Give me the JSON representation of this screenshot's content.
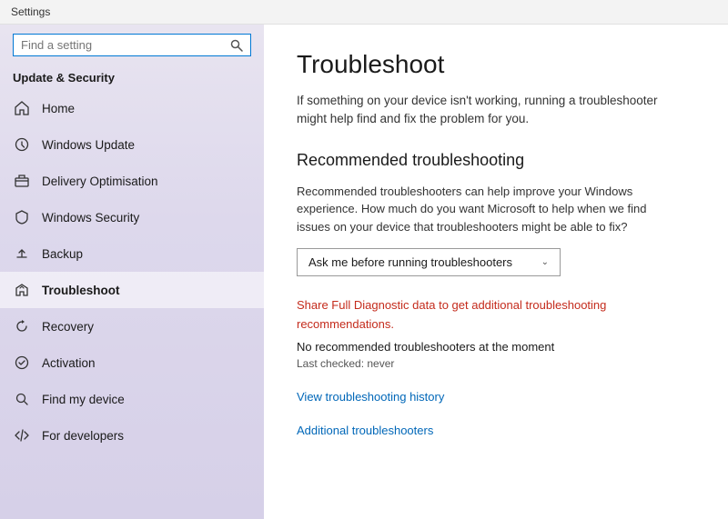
{
  "titleBar": {
    "label": "Settings"
  },
  "sidebar": {
    "searchPlaceholder": "Find a setting",
    "sectionTitle": "Update & Security",
    "items": [
      {
        "id": "home",
        "label": "Home",
        "icon": "home"
      },
      {
        "id": "windows-update",
        "label": "Windows Update",
        "icon": "windows-update"
      },
      {
        "id": "delivery-optimisation",
        "label": "Delivery Optimisation",
        "icon": "delivery"
      },
      {
        "id": "windows-security",
        "label": "Windows Security",
        "icon": "shield"
      },
      {
        "id": "backup",
        "label": "Backup",
        "icon": "backup"
      },
      {
        "id": "troubleshoot",
        "label": "Troubleshoot",
        "icon": "troubleshoot",
        "active": true
      },
      {
        "id": "recovery",
        "label": "Recovery",
        "icon": "recovery"
      },
      {
        "id": "activation",
        "label": "Activation",
        "icon": "activation"
      },
      {
        "id": "find-my-device",
        "label": "Find my device",
        "icon": "find-device"
      },
      {
        "id": "for-developers",
        "label": "For developers",
        "icon": "developers"
      }
    ]
  },
  "main": {
    "pageTitle": "Troubleshoot",
    "pageDescription": "If something on your device isn't working, running a troubleshooter might help find and fix the problem for you.",
    "sectionHeading": "Recommended troubleshooting",
    "recommendedDesc": "Recommended troubleshooters can help improve your Windows experience. How much do you want Microsoft to help when we find issues on your device that troubleshooters might be able to fix?",
    "dropdownValue": "Ask me before running troubleshooters",
    "shareLink": "Share Full Diagnostic data to get additional troubleshooting recommendations.",
    "noTroubleshooters": "No recommended troubleshooters at the moment",
    "lastChecked": "Last checked: never",
    "viewHistoryLink": "View troubleshooting history",
    "additionalLink": "Additional troubleshooters"
  }
}
